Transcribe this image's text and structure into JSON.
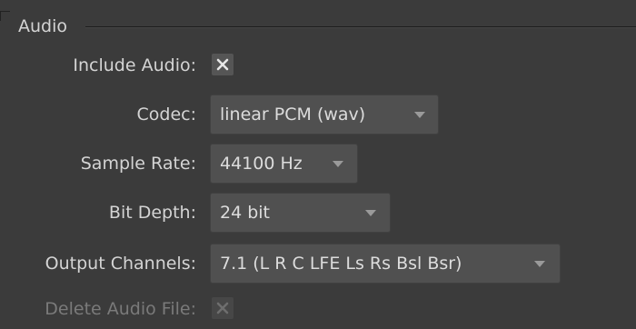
{
  "audio": {
    "title": "Audio",
    "include_audio": {
      "label": "Include Audio:",
      "checked": true
    },
    "codec": {
      "label": "Codec:",
      "value": "linear PCM (wav)"
    },
    "sample_rate": {
      "label": "Sample Rate:",
      "value": "44100 Hz"
    },
    "bit_depth": {
      "label": "Bit Depth:",
      "value": "24 bit"
    },
    "output_channels": {
      "label": "Output Channels:",
      "value": "7.1 (L R C LFE Ls Rs Bsl Bsr)"
    },
    "delete_audio_file": {
      "label": "Delete Audio File:",
      "checked": true,
      "disabled": true
    }
  },
  "colors": {
    "background": "#3b3b3b",
    "control": "#505050",
    "text": "#d4d4d4",
    "disabled_text": "#7a7a7a"
  }
}
